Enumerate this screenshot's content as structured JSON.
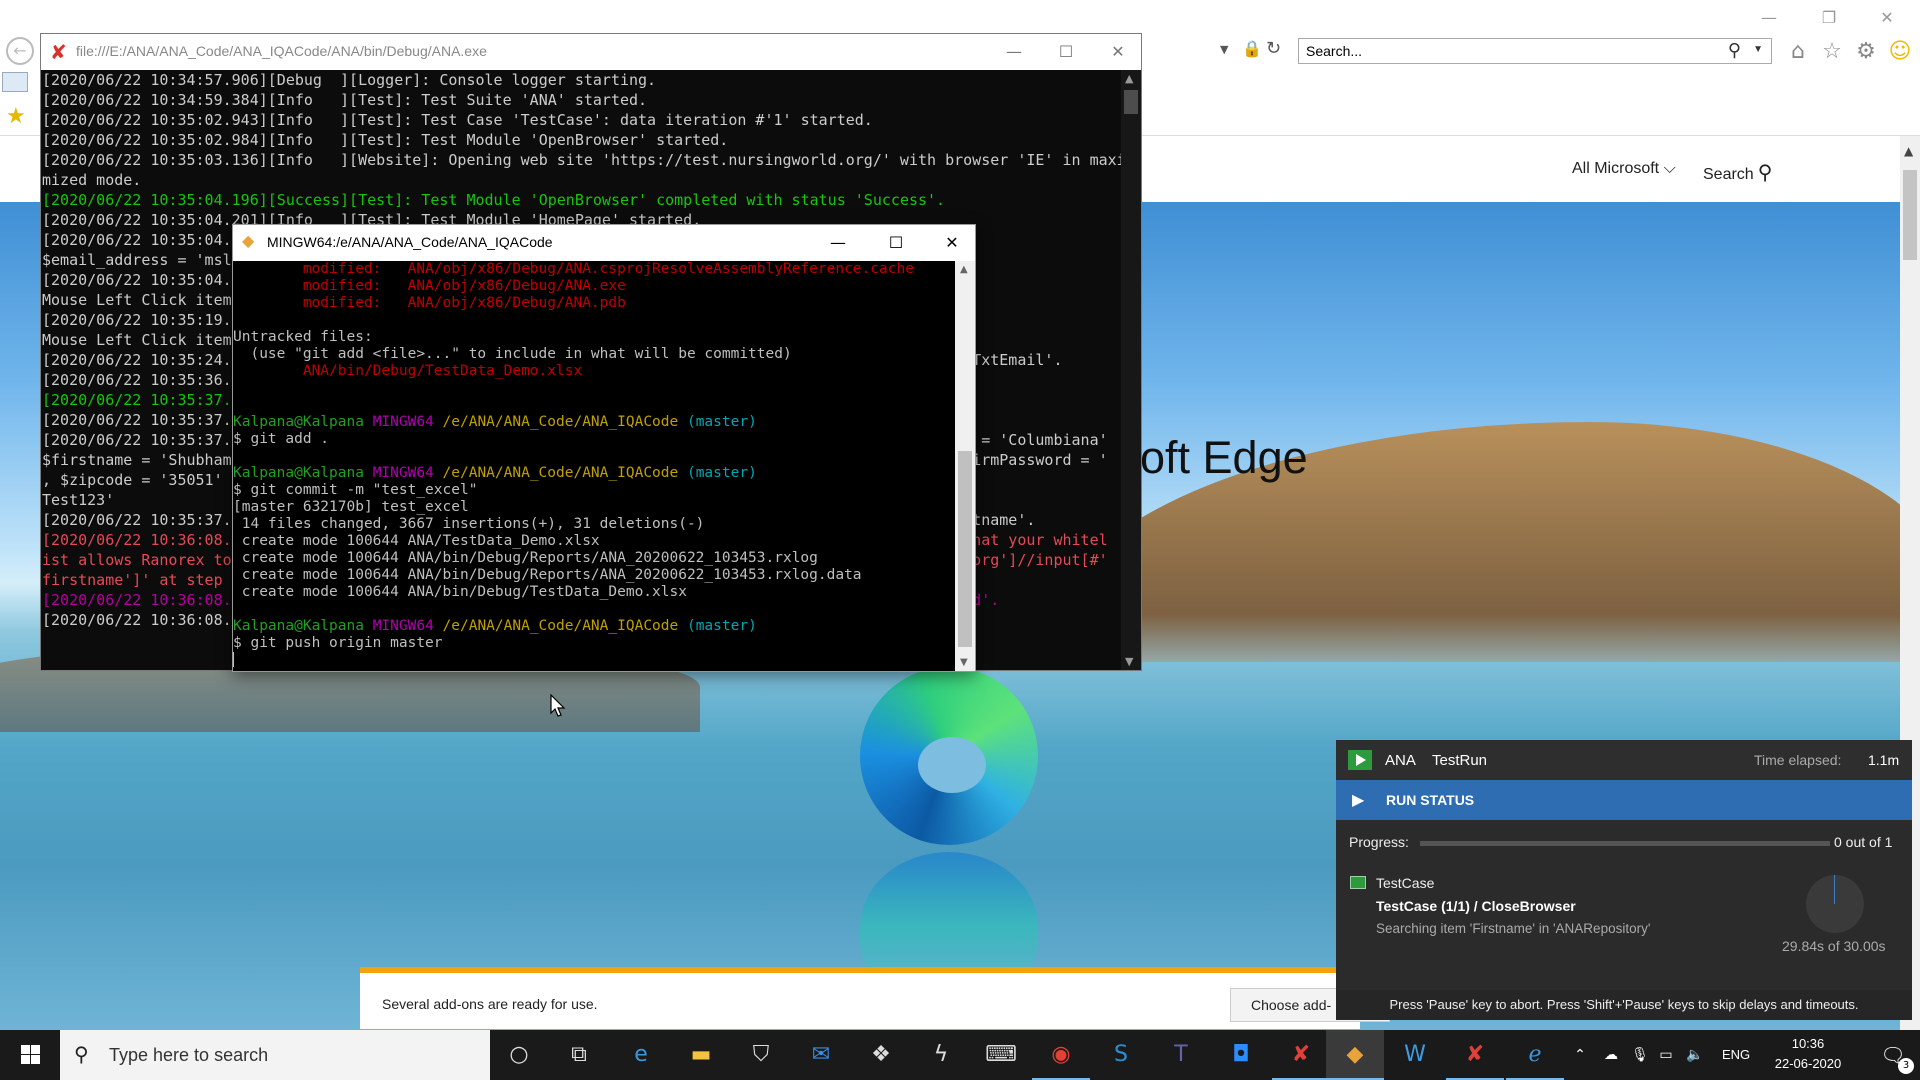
{
  "ie": {
    "search_placeholder": "Search...",
    "nav_all_microsoft": "All Microsoft ⌵",
    "nav_search": "Search",
    "hero_title": "oft Edge",
    "notification_text": "Several add-ons are ready for use.",
    "notification_button": "Choose add-"
  },
  "console": {
    "title": "file:///E:/ANA/ANA_Code/ANA_IQACode/ANA/bin/Debug/ANA.exe",
    "lines": [
      {
        "text": "[2020/06/22 10:34:57.906][Debug  ][Logger]: Console logger starting.",
        "style": "normal"
      },
      {
        "text": "[2020/06/22 10:34:59.384][Info   ][Test]: Test Suite 'ANA' started.",
        "style": "normal"
      },
      {
        "text": "[2020/06/22 10:35:02.943][Info   ][Test]: Test Case 'TestCase': data iteration #'1' started.",
        "style": "normal"
      },
      {
        "text": "[2020/06/22 10:35:02.984][Info   ][Test]: Test Module 'OpenBrowser' started.",
        "style": "normal"
      },
      {
        "text": "[2020/06/22 10:35:03.136][Info   ][Website]: Opening web site 'https://test.nursingworld.org/' with browser 'IE' in maxi",
        "style": "normal"
      },
      {
        "text": "mized mode.",
        "style": "normal"
      },
      {
        "text": "[2020/06/22 10:35:04.196][Success][Test]: Test Module 'OpenBrowser' completed with status 'Success'.",
        "style": "success"
      },
      {
        "text": "[2020/06/22 10:35:04.201][Info   ][Test]: Test Module 'HomePage' started.",
        "style": "normal"
      },
      {
        "text": "[2020/06/22 10:35:04.",
        "style": "normal"
      },
      {
        "text": "$email_address = 'msl",
        "style": "normal"
      },
      {
        "text": "[2020/06/22 10:35:04.",
        "style": "normal"
      },
      {
        "text": "Mouse Left Click item",
        "style": "normal"
      },
      {
        "text": "[2020/06/22 10:35:19.",
        "style": "normal"
      },
      {
        "text": "Mouse Left Click item",
        "style": "normal"
      },
      {
        "text": "[2020/06/22 10:35:24.0                                                                                'TxtEmail'.",
        "style": "normal"
      },
      {
        "text": "[2020/06/22 10:35:36.1",
        "style": "normal"
      },
      {
        "text": "[2020/06/22 10:35:37.5",
        "style": "success"
      },
      {
        "text": "[2020/06/22 10:35:37.",
        "style": "normal"
      },
      {
        "text": "[2020/06/22 10:35:37.0                                                                                y = 'Columbiana'",
        "style": "normal"
      },
      {
        "text": "$firstname = 'Shubham                                                                                 firmPassword = '",
        "style": "normal"
      },
      {
        "text": ", $zipcode = '35051'",
        "style": "normal"
      },
      {
        "text": "Test123'",
        "style": "normal"
      },
      {
        "text": "[2020/06/22 10:35:37.                                                                                 stname'.",
        "style": "normal"
      },
      {
        "text": "[2020/06/22 10:36:08.!                                                                                that your whitel",
        "style": "error"
      },
      {
        "text": "ist allows Ranorex to                                                                                 .org']//input[#'",
        "style": "error"
      },
      {
        "text": "firstname']' at step",
        "style": "error"
      },
      {
        "text": "[2020/06/22 10:36:08.                                                                                 ed'.",
        "style": "magenta"
      },
      {
        "text": "[2020/06/22 10:36:08.",
        "style": "normal"
      }
    ]
  },
  "mingw": {
    "title": "MINGW64:/e/ANA/ANA_Code/ANA_IQACode",
    "lines": [
      [
        {
          "t": "        modified:   ANA/obj/x86/Debug/ANA.csprojResolveAssemblyReference.cache",
          "c": "red"
        }
      ],
      [
        {
          "t": "        modified:   ANA/obj/x86/Debug/ANA.exe",
          "c": "red"
        }
      ],
      [
        {
          "t": "        modified:   ANA/obj/x86/Debug/ANA.pdb",
          "c": "red"
        }
      ],
      [
        {
          "t": "",
          "c": ""
        }
      ],
      [
        {
          "t": "Untracked files:",
          "c": ""
        }
      ],
      [
        {
          "t": "  (use \"git add <file>...\" to include in what will be committed)",
          "c": ""
        }
      ],
      [
        {
          "t": "        ANA/bin/Debug/TestData_Demo.xlsx",
          "c": "red"
        }
      ],
      [
        {
          "t": "",
          "c": ""
        }
      ],
      [
        {
          "t": "",
          "c": ""
        }
      ],
      [
        {
          "t": "Kalpana@Kalpana ",
          "c": "green"
        },
        {
          "t": "MINGW64 ",
          "c": "magenta"
        },
        {
          "t": "/e/ANA/ANA_Code/ANA_IQACode ",
          "c": "yellow"
        },
        {
          "t": "(master)",
          "c": "cyan"
        }
      ],
      [
        {
          "t": "$ git add .",
          "c": ""
        }
      ],
      [
        {
          "t": "",
          "c": ""
        }
      ],
      [
        {
          "t": "Kalpana@Kalpana ",
          "c": "green"
        },
        {
          "t": "MINGW64 ",
          "c": "magenta"
        },
        {
          "t": "/e/ANA/ANA_Code/ANA_IQACode ",
          "c": "yellow"
        },
        {
          "t": "(master)",
          "c": "cyan"
        }
      ],
      [
        {
          "t": "$ git commit -m \"test_excel\"",
          "c": ""
        }
      ],
      [
        {
          "t": "[master 632170b] test_excel",
          "c": ""
        }
      ],
      [
        {
          "t": " 14 files changed, 3667 insertions(+), 31 deletions(-)",
          "c": ""
        }
      ],
      [
        {
          "t": " create mode 100644 ANA/TestData_Demo.xlsx",
          "c": ""
        }
      ],
      [
        {
          "t": " create mode 100644 ANA/bin/Debug/Reports/ANA_20200622_103453.rxlog",
          "c": ""
        }
      ],
      [
        {
          "t": " create mode 100644 ANA/bin/Debug/Reports/ANA_20200622_103453.rxlog.data",
          "c": ""
        }
      ],
      [
        {
          "t": " create mode 100644 ANA/bin/Debug/TestData_Demo.xlsx",
          "c": ""
        }
      ],
      [
        {
          "t": "",
          "c": ""
        }
      ],
      [
        {
          "t": "Kalpana@Kalpana ",
          "c": "green"
        },
        {
          "t": "MINGW64 ",
          "c": "magenta"
        },
        {
          "t": "/e/ANA/ANA_Code/ANA_IQACode ",
          "c": "yellow"
        },
        {
          "t": "(master)",
          "c": "cyan"
        }
      ],
      [
        {
          "t": "$ git push origin master",
          "c": ""
        }
      ]
    ]
  },
  "ranorex": {
    "project": "ANA",
    "run": "TestRun",
    "elapsed_label": "Time elapsed:",
    "elapsed": "1.1m",
    "status_label": "RUN STATUS",
    "progress_label": "Progress:",
    "progress_fraction": 0,
    "progress_count": "0 out of 1",
    "testcase": "TestCase",
    "step": "TestCase (1/1) / CloseBrowser",
    "detail": "Searching item 'Firstname' in 'ANARepository'",
    "timer": "29.84s of 30.00s",
    "footer": "Press 'Pause' key to abort. Press 'Shift'+'Pause' keys to skip delays and timeouts."
  },
  "taskbar": {
    "search_placeholder": "Type here to search",
    "language": "ENG",
    "time": "10:36",
    "date": "22-06-2020",
    "notification_count": "3"
  }
}
